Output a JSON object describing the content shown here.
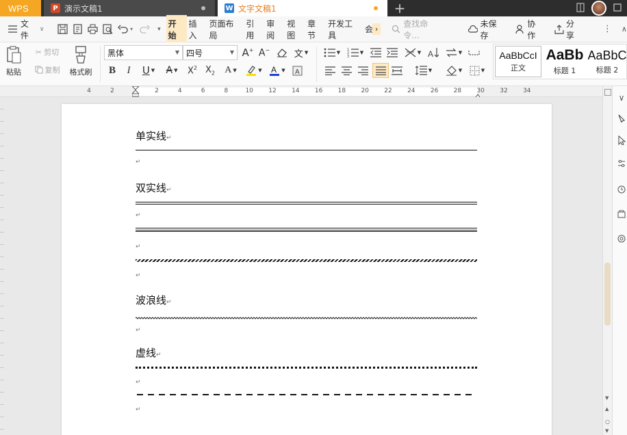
{
  "titlebar": {
    "app_button": "WPS",
    "tabs": [
      {
        "label": "演示文稿1",
        "icon": "P"
      },
      {
        "label": "文字文稿1",
        "icon": "W"
      }
    ],
    "new_tab": "+"
  },
  "menubar": {
    "file_label": "文件",
    "tabs": [
      "开始",
      "插入",
      "页面布局",
      "引用",
      "审阅",
      "视图",
      "章节",
      "开发工具",
      "会"
    ],
    "active_tab": "开始",
    "search_placeholder": "查找命令...",
    "unsaved_label": "未保存",
    "collab_label": "协作",
    "share_label": "分享"
  },
  "ribbon": {
    "paste_label": "粘贴",
    "cut_label": "剪切",
    "copy_label": "复制",
    "format_painter_label": "格式刷",
    "font_name": "黑体",
    "font_size": "四号",
    "styles": [
      {
        "sample": "AaBbCcI",
        "name": "正文"
      },
      {
        "sample": "AaBb",
        "name": "标题 1"
      },
      {
        "sample": "AaBbC",
        "name": "标题 2"
      }
    ]
  },
  "ruler": {
    "ticks": [
      "4",
      "2",
      "2",
      "4",
      "6",
      "8",
      "10",
      "12",
      "14",
      "16",
      "18",
      "20",
      "22",
      "24",
      "26",
      "28",
      "30",
      "32",
      "34"
    ]
  },
  "document": {
    "heading_single": "单实线",
    "heading_double": "双实线",
    "heading_wavy": "波浪线",
    "heading_dotted": "虚线",
    "para_mark": "↵"
  },
  "colors": {
    "accent": "#f5a623",
    "active_tab_bg": "#fde9c4",
    "doc_tab_text": "#e87c1e",
    "highlight_yellow": "#f5e100",
    "font_color_blue": "#1f3fd6"
  }
}
